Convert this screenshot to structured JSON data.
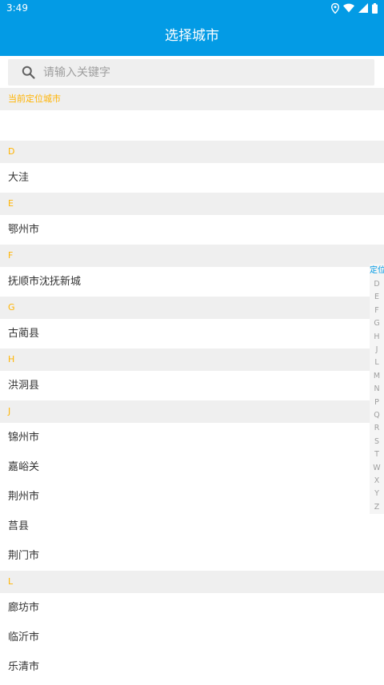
{
  "status": {
    "time": "3:49",
    "icons": [
      "location-icon",
      "wifi-icon",
      "signal-icon",
      "battery-icon"
    ]
  },
  "header": {
    "title": "选择城市"
  },
  "search": {
    "placeholder": "请输入关键字",
    "value": ""
  },
  "current_location": {
    "label": "当前定位城市",
    "value": ""
  },
  "sections": [
    {
      "letter": "D",
      "cities": [
        "大洼"
      ]
    },
    {
      "letter": "E",
      "cities": [
        "鄂州市"
      ]
    },
    {
      "letter": "F",
      "cities": [
        "抚顺市沈抚新城"
      ]
    },
    {
      "letter": "G",
      "cities": [
        "古蔺县"
      ]
    },
    {
      "letter": "H",
      "cities": [
        "洪洞县"
      ]
    },
    {
      "letter": "J",
      "cities": [
        "锦州市",
        "嘉峪关",
        "荆州市",
        "莒县",
        "荆门市"
      ]
    },
    {
      "letter": "L",
      "cities": [
        "廊坊市",
        "临沂市",
        "乐清市"
      ]
    }
  ],
  "index_bar": {
    "location_label": "定位",
    "letters": [
      "D",
      "E",
      "F",
      "G",
      "H",
      "J",
      "L",
      "M",
      "N",
      "P",
      "Q",
      "R",
      "S",
      "T",
      "W",
      "X",
      "Y",
      "Z"
    ]
  },
  "colors": {
    "primary": "#039be5",
    "section_text": "#ffb300",
    "section_bg": "#efefef",
    "index_text": "#9e9e9e"
  }
}
